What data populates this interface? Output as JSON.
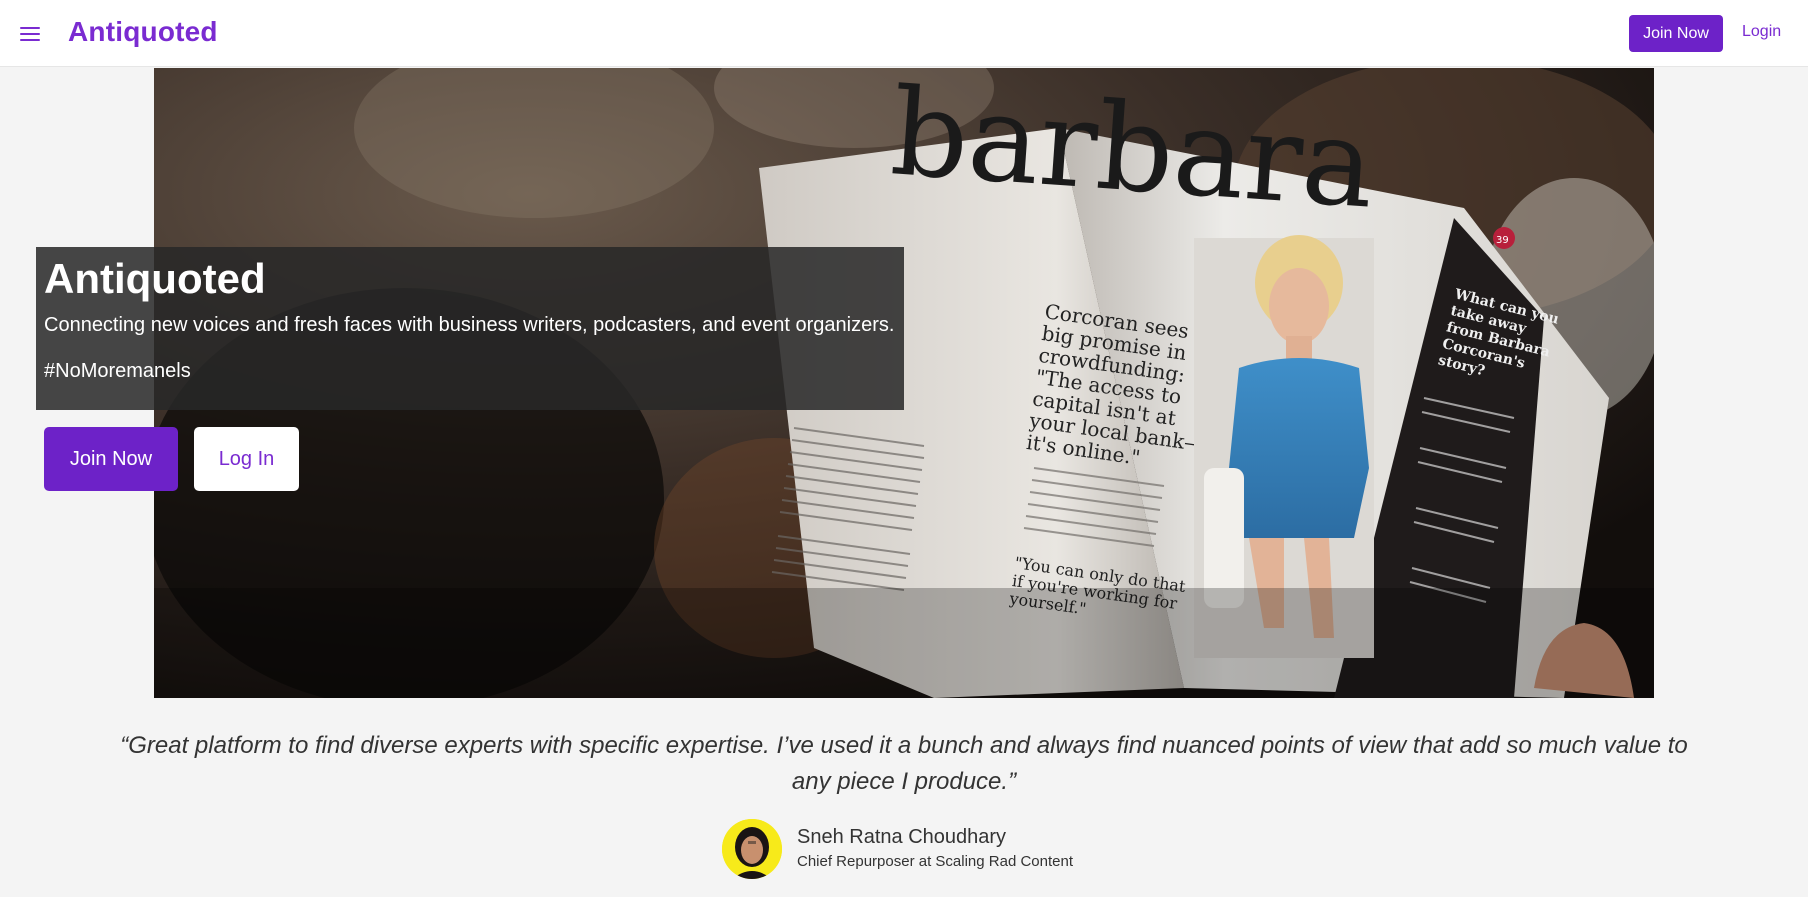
{
  "header": {
    "brand": "Antiquoted",
    "join_label": "Join Now",
    "login_label": "Login"
  },
  "hero": {
    "title": "Antiquoted",
    "subtitle": "Connecting new voices and fresh faces with business writers, podcasters, and event organizers.",
    "hashtag": "#NoMoremanels",
    "join_label": "Join Now",
    "login_label": "Log In",
    "image_text": {
      "headline": "barbara",
      "pull_quote": "Corcoran sees big promise in crowdfunding: “The access to capital isn't at your local bank— it's online.”",
      "side_heading": "What can you take away from Barbara Corcoran's story?",
      "page_number": "39",
      "bottom_quote": "“You can only do that if you're working for yourself.”"
    }
  },
  "testimonial": {
    "quote": "“Great platform to find diverse experts with specific expertise. I’ve used it a bunch and always find nuanced points of view that add so much value to any piece I produce.”",
    "name": "Sneh Ratna Choudhary",
    "role": "Chief Repurposer at Scaling Rad Content"
  },
  "colors": {
    "accent": "#6d22c8",
    "brand": "#7a2bd1",
    "page_bg": "#f4f4f4",
    "overlay": "#282828"
  },
  "icons": {
    "menu": "hamburger-menu-icon"
  }
}
